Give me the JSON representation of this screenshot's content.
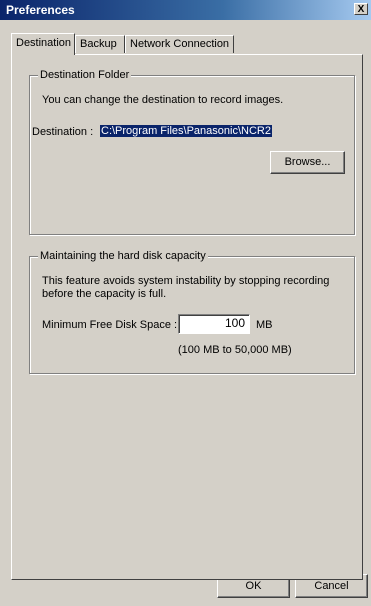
{
  "window": {
    "title": "Preferences",
    "close_glyph": "X"
  },
  "tabs": [
    {
      "label": "Destination"
    },
    {
      "label": "Backup"
    },
    {
      "label": "Network Connection"
    }
  ],
  "destination_group": {
    "legend": "Destination Folder",
    "description": "You can change the destination to record images.",
    "label": "Destination :",
    "value": "C:\\Program Files\\Panasonic\\NCR2",
    "browse_label": "Browse..."
  },
  "disk_group": {
    "legend": "Maintaining the hard disk capacity",
    "description_line1": "This feature avoids system instability by stopping recording",
    "description_line2": "before the capacity is full.",
    "min_label": "Minimum Free Disk Space :",
    "min_value": "100",
    "unit": "MB",
    "range_hint": "(100 MB to 50,000 MB)"
  },
  "footer": {
    "ok_label": "OK",
    "cancel_label": "Cancel"
  }
}
